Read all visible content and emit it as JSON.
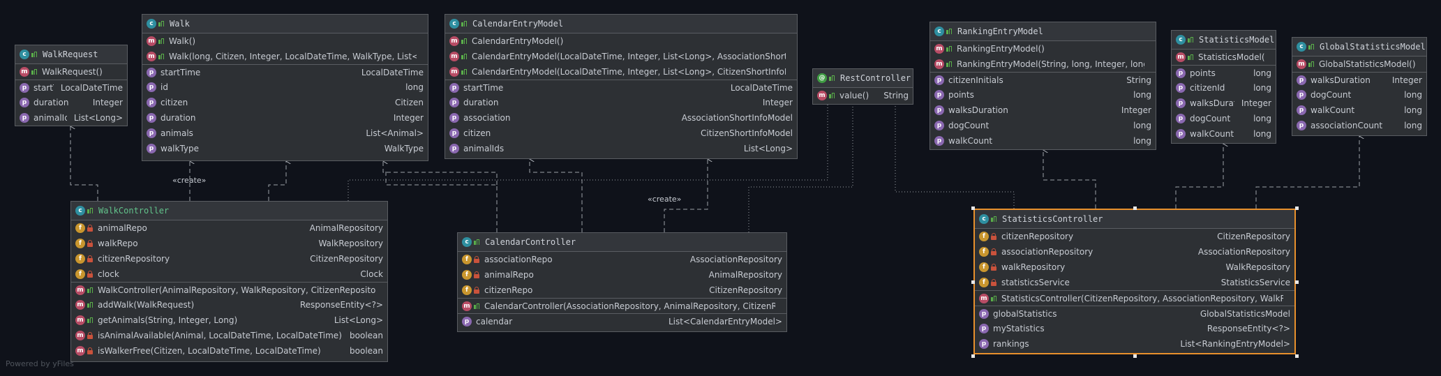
{
  "classes": {
    "walk_request": {
      "name": "WalkRequest",
      "members": [
        {
          "kind": "m",
          "vis": "public",
          "name": "WalkRequest()",
          "type": ""
        },
        {
          "kind": "p",
          "vis": "",
          "name": "startTime",
          "type": "LocalDateTime",
          "sep": true
        },
        {
          "kind": "p",
          "vis": "",
          "name": "duration",
          "type": "Integer"
        },
        {
          "kind": "p",
          "vis": "",
          "name": "animalIds",
          "type": "List<Long>"
        }
      ]
    },
    "walk": {
      "name": "Walk",
      "members": [
        {
          "kind": "m",
          "vis": "public",
          "name": "Walk()",
          "type": ""
        },
        {
          "kind": "m",
          "vis": "public",
          "name": "Walk(long, Citizen, Integer, LocalDateTime, WalkType, List<Animal>)",
          "type": ""
        },
        {
          "kind": "p",
          "vis": "",
          "name": "startTime",
          "type": "LocalDateTime",
          "sep": true
        },
        {
          "kind": "p",
          "vis": "",
          "name": "id",
          "type": "long"
        },
        {
          "kind": "p",
          "vis": "",
          "name": "citizen",
          "type": "Citizen"
        },
        {
          "kind": "p",
          "vis": "",
          "name": "duration",
          "type": "Integer"
        },
        {
          "kind": "p",
          "vis": "",
          "name": "animals",
          "type": "List<Animal>"
        },
        {
          "kind": "p",
          "vis": "",
          "name": "walkType",
          "type": "WalkType"
        }
      ]
    },
    "calendar_entry_model": {
      "name": "CalendarEntryModel",
      "members": [
        {
          "kind": "m",
          "vis": "public",
          "name": "CalendarEntryModel()",
          "type": ""
        },
        {
          "kind": "m",
          "vis": "public",
          "name": "CalendarEntryModel(LocalDateTime, Integer, List<Long>, AssociationShortInfoModel)",
          "type": ""
        },
        {
          "kind": "m",
          "vis": "public",
          "name": "CalendarEntryModel(LocalDateTime, Integer, List<Long>, CitizenShortInfoModel)",
          "type": ""
        },
        {
          "kind": "p",
          "vis": "",
          "name": "startTime",
          "type": "LocalDateTime",
          "sep": true
        },
        {
          "kind": "p",
          "vis": "",
          "name": "duration",
          "type": "Integer"
        },
        {
          "kind": "p",
          "vis": "",
          "name": "association",
          "type": "AssociationShortInfoModel"
        },
        {
          "kind": "p",
          "vis": "",
          "name": "citizen",
          "type": "CitizenShortInfoModel"
        },
        {
          "kind": "p",
          "vis": "",
          "name": "animalIds",
          "type": "List<Long>"
        }
      ]
    },
    "rest_controller": {
      "name": "RestController",
      "members": [
        {
          "kind": "m",
          "vis": "public",
          "name": "value()",
          "type": "String"
        }
      ]
    },
    "ranking_entry_model": {
      "name": "RankingEntryModel",
      "members": [
        {
          "kind": "m",
          "vis": "public",
          "name": "RankingEntryModel()",
          "type": ""
        },
        {
          "kind": "m",
          "vis": "public",
          "name": "RankingEntryModel(String, long, Integer, long, long)",
          "type": ""
        },
        {
          "kind": "p",
          "vis": "",
          "name": "citizenInitials",
          "type": "String",
          "sep": true
        },
        {
          "kind": "p",
          "vis": "",
          "name": "points",
          "type": "long"
        },
        {
          "kind": "p",
          "vis": "",
          "name": "walksDuration",
          "type": "Integer"
        },
        {
          "kind": "p",
          "vis": "",
          "name": "dogCount",
          "type": "long"
        },
        {
          "kind": "p",
          "vis": "",
          "name": "walkCount",
          "type": "long"
        }
      ]
    },
    "statistics_model": {
      "name": "StatisticsModel",
      "members": [
        {
          "kind": "m",
          "vis": "public",
          "name": "StatisticsModel()",
          "type": ""
        },
        {
          "kind": "p",
          "vis": "",
          "name": "points",
          "type": "long",
          "sep": true
        },
        {
          "kind": "p",
          "vis": "",
          "name": "citizenId",
          "type": "long"
        },
        {
          "kind": "p",
          "vis": "",
          "name": "walksDuration",
          "type": "Integer"
        },
        {
          "kind": "p",
          "vis": "",
          "name": "dogCount",
          "type": "long"
        },
        {
          "kind": "p",
          "vis": "",
          "name": "walkCount",
          "type": "long"
        }
      ]
    },
    "global_statistics_model": {
      "name": "GlobalStatisticsModel",
      "members": [
        {
          "kind": "m",
          "vis": "public",
          "name": "GlobalStatisticsModel()",
          "type": ""
        },
        {
          "kind": "p",
          "vis": "",
          "name": "walksDuration",
          "type": "Integer",
          "sep": true
        },
        {
          "kind": "p",
          "vis": "",
          "name": "dogCount",
          "type": "long"
        },
        {
          "kind": "p",
          "vis": "",
          "name": "walkCount",
          "type": "long"
        },
        {
          "kind": "p",
          "vis": "",
          "name": "associationCount",
          "type": "long"
        }
      ]
    },
    "walk_controller": {
      "name": "WalkController",
      "members": [
        {
          "kind": "f",
          "vis": "private",
          "name": "animalRepo",
          "type": "AnimalRepository"
        },
        {
          "kind": "f",
          "vis": "private",
          "name": "walkRepo",
          "type": "WalkRepository"
        },
        {
          "kind": "f",
          "vis": "private",
          "name": "citizenRepository",
          "type": "CitizenRepository"
        },
        {
          "kind": "f",
          "vis": "private",
          "name": "clock",
          "type": "Clock"
        },
        {
          "kind": "m",
          "vis": "public",
          "name": "WalkController(AnimalRepository, WalkRepository, CitizenRepository, Clock)",
          "type": "",
          "sep": true
        },
        {
          "kind": "m",
          "vis": "public",
          "name": "addWalk(WalkRequest)",
          "type": "ResponseEntity<?>"
        },
        {
          "kind": "m",
          "vis": "public",
          "name": "getAnimals(String, Integer, Long)",
          "type": "List<Long>"
        },
        {
          "kind": "m",
          "vis": "private",
          "name": "isAnimalAvailable(Animal, LocalDateTime, LocalDateTime)",
          "type": "boolean"
        },
        {
          "kind": "m",
          "vis": "private",
          "name": "isWalkerFree(Citizen, LocalDateTime, LocalDateTime)",
          "type": "boolean"
        }
      ]
    },
    "calendar_controller": {
      "name": "CalendarController",
      "members": [
        {
          "kind": "f",
          "vis": "private",
          "name": "associationRepo",
          "type": "AssociationRepository"
        },
        {
          "kind": "f",
          "vis": "private",
          "name": "animalRepo",
          "type": "AnimalRepository"
        },
        {
          "kind": "f",
          "vis": "private",
          "name": "citizenRepo",
          "type": "CitizenRepository"
        },
        {
          "kind": "m",
          "vis": "public",
          "name": "CalendarController(AssociationRepository, AnimalRepository, CitizenRepository)",
          "type": "",
          "sep": true
        },
        {
          "kind": "p",
          "vis": "",
          "name": "calendar",
          "type": "List<CalendarEntryModel>",
          "sep": true
        }
      ]
    },
    "statistics_controller": {
      "name": "StatisticsController",
      "members": [
        {
          "kind": "f",
          "vis": "private",
          "name": "citizenRepository",
          "type": "CitizenRepository"
        },
        {
          "kind": "f",
          "vis": "private",
          "name": "associationRepository",
          "type": "AssociationRepository"
        },
        {
          "kind": "f",
          "vis": "private",
          "name": "walkRepository",
          "type": "WalkRepository"
        },
        {
          "kind": "f",
          "vis": "private",
          "name": "statisticsService",
          "type": "StatisticsService"
        },
        {
          "kind": "m",
          "vis": "public",
          "name": "StatisticsController(CitizenRepository, AssociationRepository, WalkRepository)",
          "type": "",
          "sep": true
        },
        {
          "kind": "p",
          "vis": "",
          "name": "globalStatistics",
          "type": "GlobalStatisticsModel",
          "sep": true
        },
        {
          "kind": "p",
          "vis": "",
          "name": "myStatistics",
          "type": "ResponseEntity<?>"
        },
        {
          "kind": "p",
          "vis": "",
          "name": "rankings",
          "type": "List<RankingEntryModel>"
        }
      ]
    }
  },
  "edge_labels": {
    "walk_create": "«create»",
    "calendar_create": "«create»"
  },
  "footer": "Powered by yFiles",
  "colors": {
    "background": "#0f121a",
    "node_fill": "#2d3034",
    "selected_border": "#e8902c",
    "edge": "#9da1a8"
  }
}
